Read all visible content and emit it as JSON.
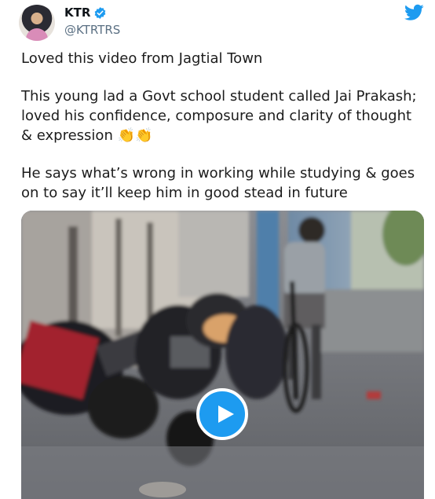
{
  "author": {
    "name": "KTR",
    "handle": "@KTRTRS",
    "verified": true
  },
  "tweet": {
    "paragraphs": [
      "Loved this video from Jagtial Town",
      "This young lad a Govt school student called Jai Prakash; loved his confidence, composure and clarity of thought & expression 👏👏",
      "He says what’s wrong in working while studying & goes on to say it’ll keep him in good stead in future"
    ]
  },
  "icons": {
    "verified": "verified-badge-icon",
    "brand": "twitter-bird-icon",
    "play": "play-icon"
  },
  "colors": {
    "brand_blue": "#1d9bf0",
    "handle_gray": "#5b7083"
  }
}
